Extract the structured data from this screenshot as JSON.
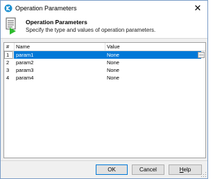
{
  "window": {
    "title": "Operation Parameters",
    "close_glyph": "✕",
    "app_icon": "app-logo-icon"
  },
  "header": {
    "title": "Operation Parameters",
    "subtitle": "Specify the type and values of operation parameters.",
    "icon": "document-play-icon"
  },
  "grid": {
    "columns": [
      "#",
      "Name",
      "Value"
    ],
    "rows": [
      {
        "num": "1",
        "name": "param1",
        "value": "None",
        "selected": true
      },
      {
        "num": "2",
        "name": "param2",
        "value": "None"
      },
      {
        "num": "3",
        "name": "param3",
        "value": "None"
      },
      {
        "num": "4",
        "name": "param4",
        "value": "None"
      }
    ],
    "ellipsis_label": "...",
    "selection_color": "#0078d7"
  },
  "buttons": {
    "ok": "OK",
    "cancel": "Cancel",
    "help_first": "H",
    "help_rest": "elp"
  }
}
